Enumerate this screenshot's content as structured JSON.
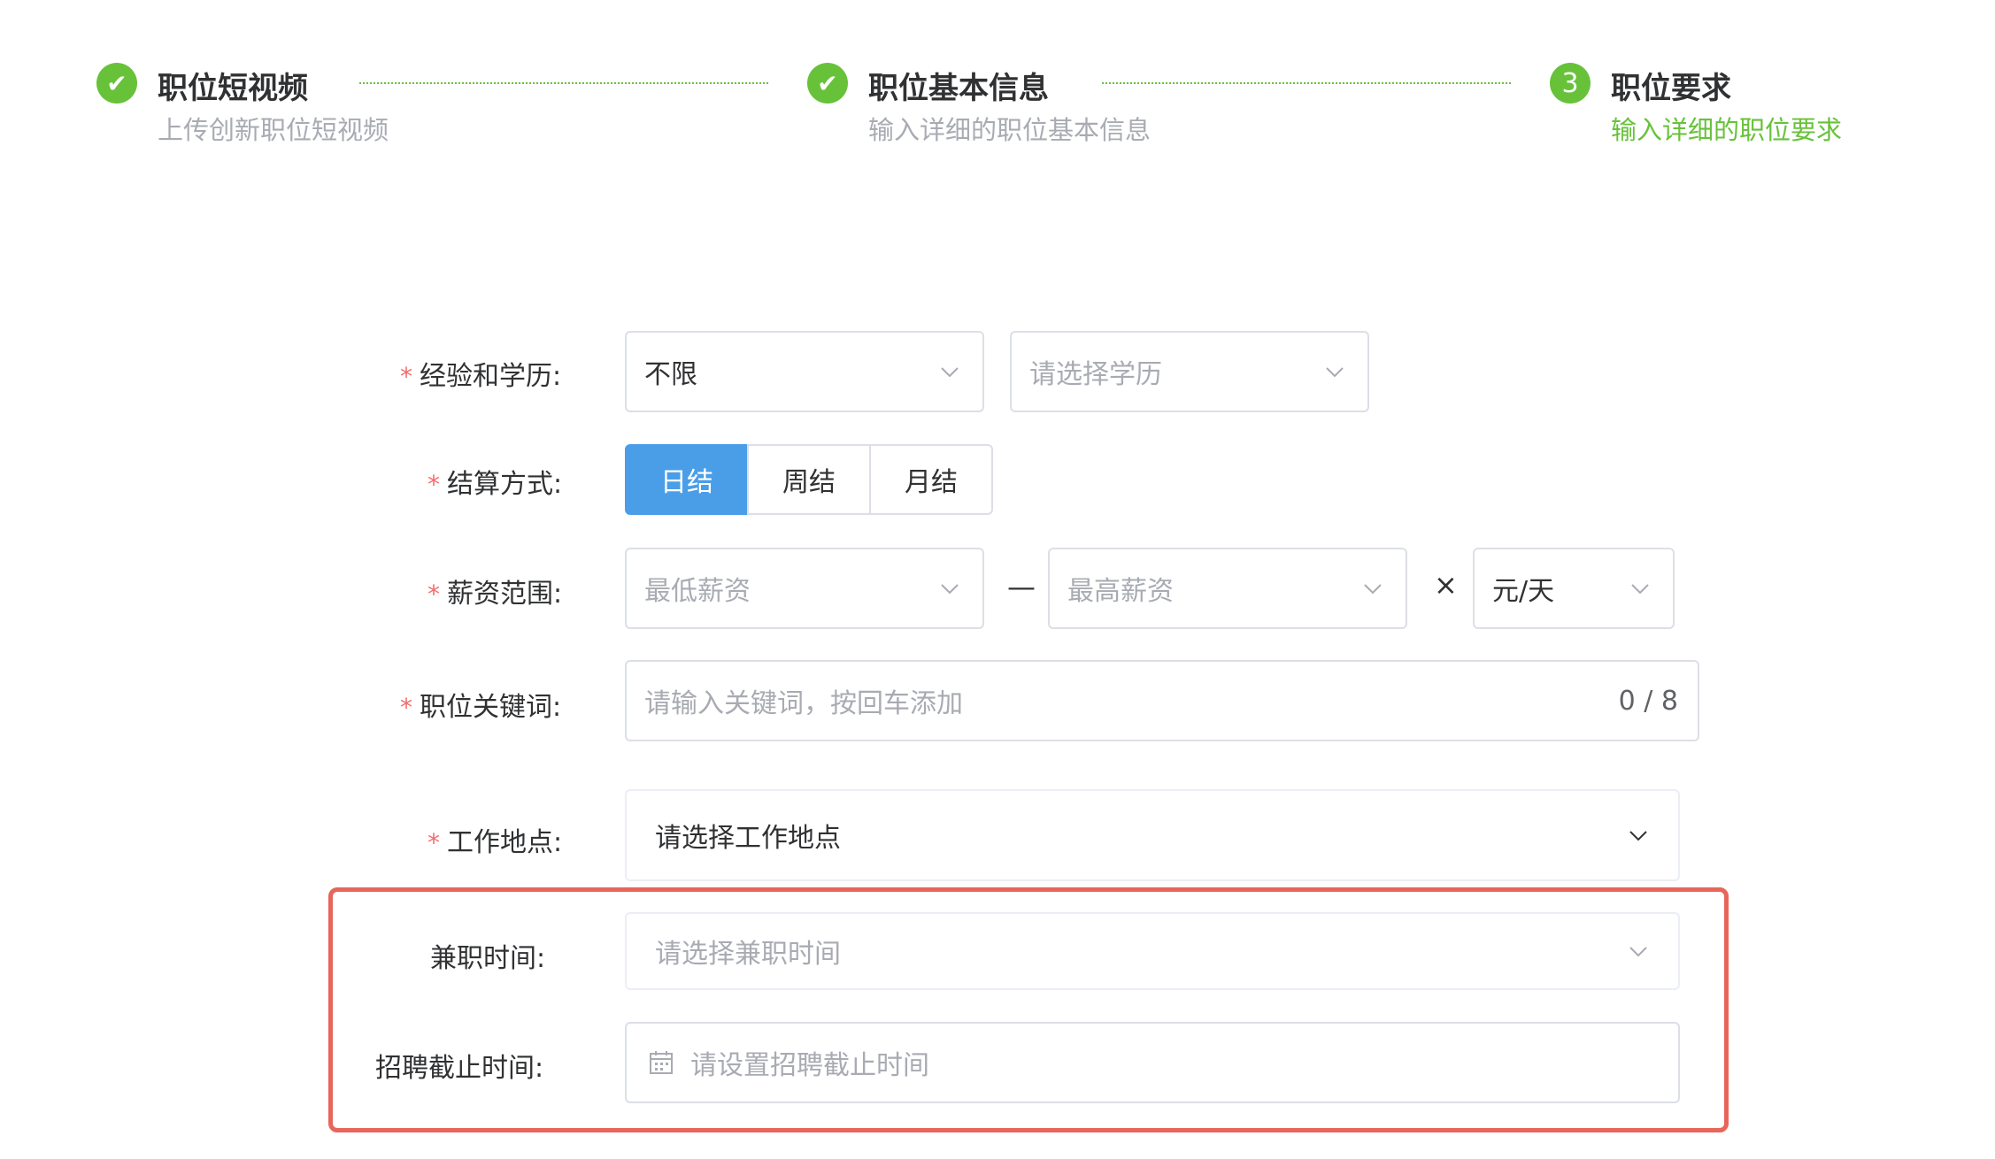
{
  "steps": [
    {
      "title": "职位短视频",
      "desc": "上传创新职位短视频",
      "icon": "check-icon",
      "mark": "✔"
    },
    {
      "title": "职位基本信息",
      "desc": "输入详细的职位基本信息",
      "icon": "check-icon",
      "mark": "✔"
    },
    {
      "title": "职位要求",
      "desc": "输入详细的职位要求",
      "icon": "step-number",
      "mark": "3"
    }
  ],
  "form": {
    "required_mark": "*",
    "experience": {
      "label": "经验和学历:",
      "experience_value": "不限",
      "education_placeholder": "请选择学历"
    },
    "settlement": {
      "label": "结算方式:",
      "options": [
        "日结",
        "周结",
        "月结"
      ],
      "selected": "日结"
    },
    "salary": {
      "label": "薪资范围:",
      "min_placeholder": "最低薪资",
      "dash": "—",
      "max_placeholder": "最高薪资",
      "times": "×",
      "unit_value": "元/天"
    },
    "keywords": {
      "label": "职位关键词:",
      "placeholder": "请输入关键词，按回车添加",
      "counter": "0 / 8"
    },
    "location": {
      "label": "工作地点:",
      "value": "请选择工作地点"
    },
    "parttime": {
      "label": "兼职时间:",
      "placeholder": "请选择兼职时间"
    },
    "deadline": {
      "label": "招聘截止时间:",
      "placeholder": "请设置招聘截止时间"
    }
  },
  "colors": {
    "accent_green": "#67c23a",
    "primary_blue": "#4a9ee8",
    "required_red": "#f56c6c",
    "highlight_red": "#e8655a"
  }
}
